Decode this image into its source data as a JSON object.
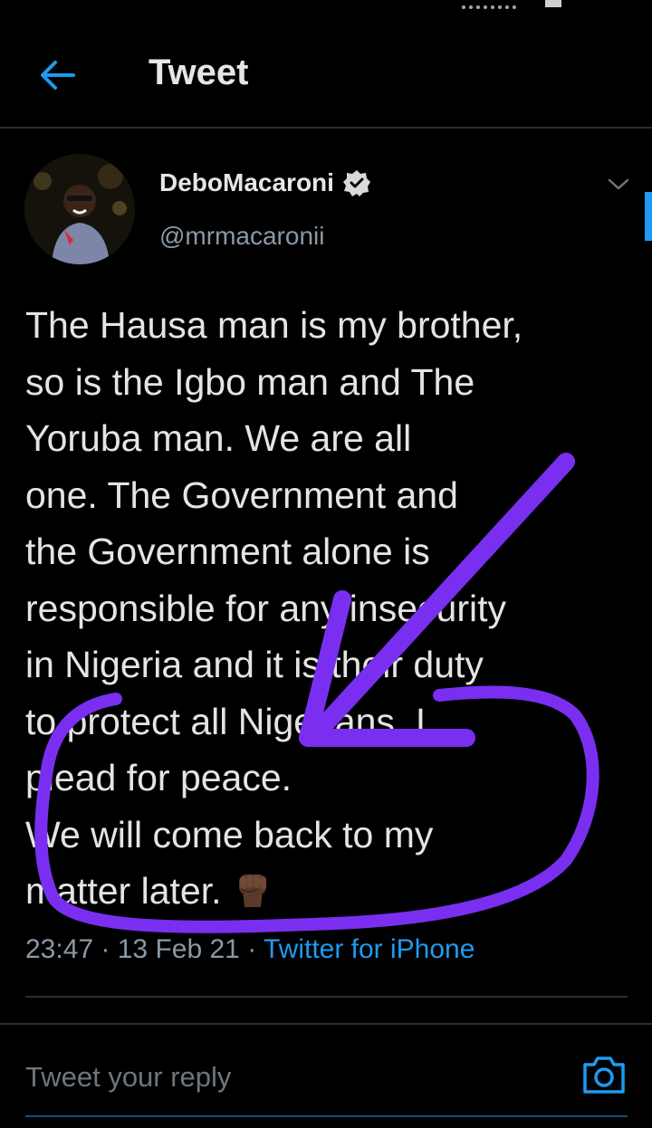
{
  "header": {
    "title": "Tweet"
  },
  "tweet": {
    "author_name": "DeboMacaroni",
    "author_handle": "@mrmacaronii",
    "text": "The Hausa man is my brother,\nso is the Igbo man and The\nYoruba man. We are all\none. The Government and\nthe Government alone is\nresponsible for any insecurity\nin Nigeria and it is their duty\nto protect all Nigerians. I\nplead for peace.\nWe will come back to my\nmatter later.",
    "emoji": "raised-fist-dark-skin-tone",
    "time": "23:47",
    "date": "13 Feb 21",
    "source": "Twitter for iPhone",
    "separator": " · "
  },
  "reply": {
    "placeholder": "Tweet your reply"
  },
  "icons": {
    "back": "arrow-left-icon",
    "verified": "verified-badge-icon",
    "more": "chevron-down-icon",
    "camera": "camera-icon"
  },
  "colors": {
    "background": "#000000",
    "accent": "#1d9bf0",
    "secondary_text": "#8b98a5",
    "annotation": "#7a2ff0"
  }
}
